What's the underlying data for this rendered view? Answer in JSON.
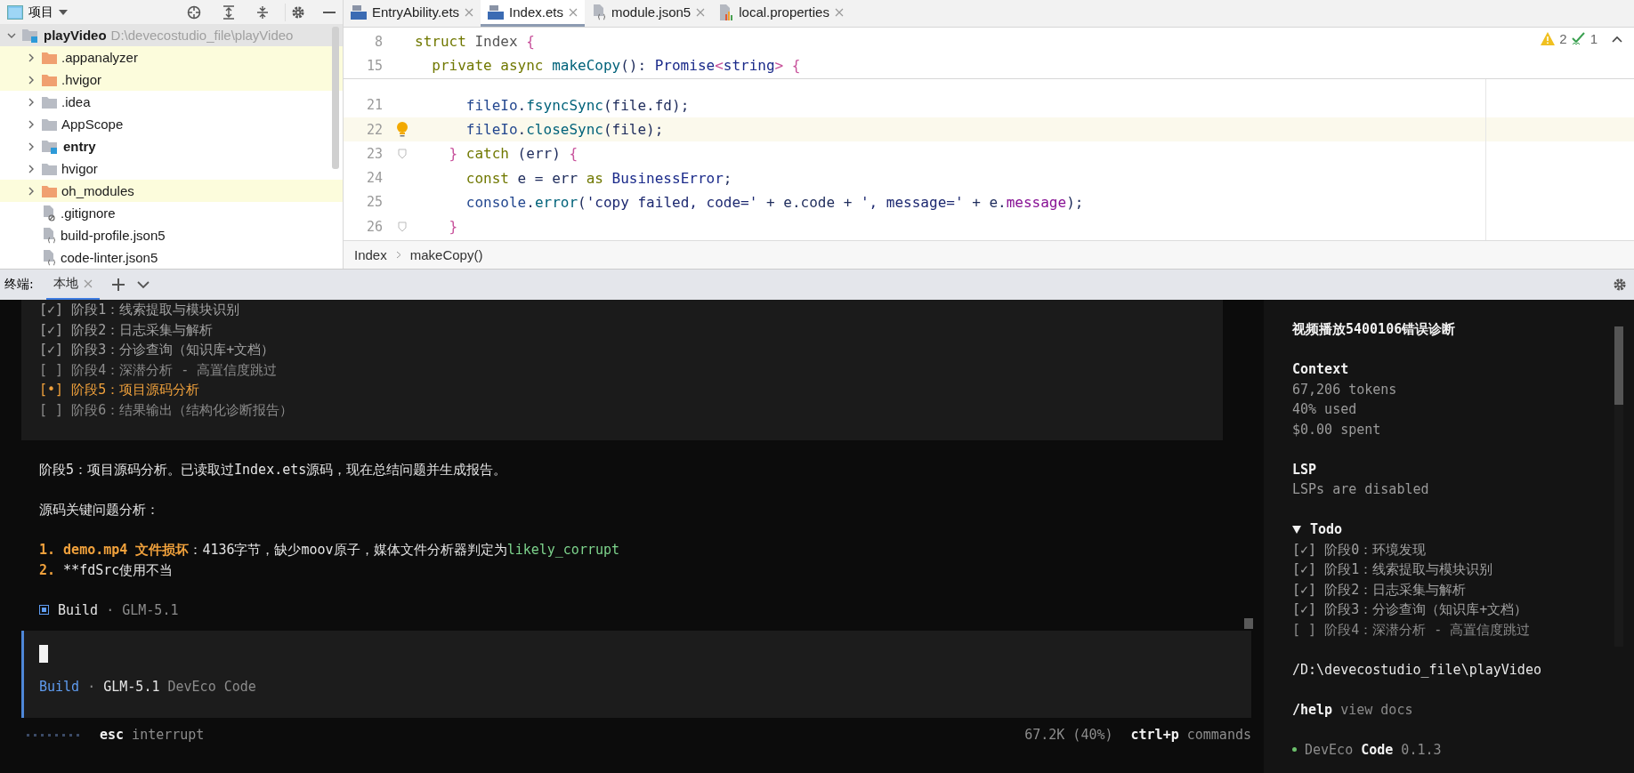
{
  "project_panel": {
    "title": "项目",
    "tree": [
      {
        "name": "playVideo",
        "path": "D:\\devecostudio_file\\playVideo",
        "kind": "project",
        "expanded": true,
        "selected": true,
        "ignored": false,
        "children": [
          {
            "name": ".appanalyzer",
            "kind": "folder",
            "expanded": false,
            "selected": false,
            "ignored": true
          },
          {
            "name": ".hvigor",
            "kind": "folder",
            "expanded": false,
            "selected": false,
            "ignored": true
          },
          {
            "name": ".idea",
            "kind": "folder",
            "expanded": false,
            "selected": false,
            "ignored": false
          },
          {
            "name": "AppScope",
            "kind": "folder",
            "expanded": false,
            "selected": false,
            "ignored": false
          },
          {
            "name": "entry",
            "kind": "module",
            "expanded": false,
            "selected": false,
            "ignored": false
          },
          {
            "name": "hvigor",
            "kind": "folder",
            "expanded": false,
            "selected": false,
            "ignored": false
          },
          {
            "name": "oh_modules",
            "kind": "folder",
            "expanded": false,
            "selected": false,
            "ignored": true
          },
          {
            "name": ".gitignore",
            "kind": "ignorefile",
            "selected": false,
            "ignored": false
          },
          {
            "name": "build-profile.json5",
            "kind": "jsonfile",
            "selected": false,
            "ignored": false
          },
          {
            "name": "code-linter.json5",
            "kind": "jsonfile",
            "selected": false,
            "ignored": false
          }
        ]
      }
    ]
  },
  "editor": {
    "tabs": [
      {
        "label": "EntryAbility.ets",
        "kind": "ets",
        "selected": false
      },
      {
        "label": "Index.ets",
        "kind": "ets",
        "selected": true
      },
      {
        "label": "module.json5",
        "kind": "json",
        "selected": false
      },
      {
        "label": "local.properties",
        "kind": "properties",
        "selected": false
      }
    ],
    "inspections": {
      "warnings": "2",
      "weak_warnings": "1"
    },
    "sticky_lines": [
      {
        "number": "8",
        "tokens": [
          {
            "kind": "kw",
            "text": "struct"
          },
          {
            "kind": "id",
            "text": " Index "
          },
          {
            "kind": "br",
            "text": "{"
          }
        ]
      },
      {
        "number": "15",
        "tokens": [
          {
            "kind": "kw",
            "text": "  private async "
          },
          {
            "kind": "fn",
            "text": "makeCopy"
          },
          {
            "kind": "pl",
            "text": "(): "
          },
          {
            "kind": "ty",
            "text": "Promise"
          },
          {
            "kind": "br",
            "text": "<"
          },
          {
            "kind": "ty",
            "text": "string"
          },
          {
            "kind": "br",
            "text": ">"
          },
          {
            "kind": "br",
            "text": " {"
          }
        ]
      }
    ],
    "lines": [
      {
        "number": "21",
        "current": false,
        "fold": false,
        "tokens": [
          {
            "kind": "ob",
            "text": "      fileIo"
          },
          {
            "kind": "pl",
            "text": "."
          },
          {
            "kind": "fn",
            "text": "fsyncSync"
          },
          {
            "kind": "pl",
            "text": "(file.fd);"
          }
        ]
      },
      {
        "number": "22",
        "current": true,
        "fold": false,
        "tokens": [
          {
            "kind": "ob",
            "text": "      fileIo"
          },
          {
            "kind": "pl",
            "text": "."
          },
          {
            "kind": "fn",
            "text": "closeSync"
          },
          {
            "kind": "pl",
            "text": "(file);"
          }
        ]
      },
      {
        "number": "23",
        "current": false,
        "fold": true,
        "tokens": [
          {
            "kind": "br",
            "text": "    }"
          },
          {
            "kind": "kw",
            "text": " catch "
          },
          {
            "kind": "pl",
            "text": "(err) "
          },
          {
            "kind": "br",
            "text": "{"
          }
        ]
      },
      {
        "number": "24",
        "current": false,
        "fold": false,
        "tokens": [
          {
            "kind": "kw",
            "text": "      const"
          },
          {
            "kind": "pl",
            "text": " e = err "
          },
          {
            "kind": "kw",
            "text": "as"
          },
          {
            "kind": "ty",
            "text": " BusinessError"
          },
          {
            "kind": "pl",
            "text": ";"
          }
        ]
      },
      {
        "number": "25",
        "current": false,
        "fold": false,
        "tokens": [
          {
            "kind": "ob",
            "text": "      console"
          },
          {
            "kind": "pl",
            "text": "."
          },
          {
            "kind": "fn",
            "text": "error"
          },
          {
            "kind": "pl",
            "text": "("
          },
          {
            "kind": "st",
            "text": "'copy failed, code='"
          },
          {
            "kind": "pl",
            "text": " + e.code + "
          },
          {
            "kind": "st",
            "text": "', message='"
          },
          {
            "kind": "pl",
            "text": " + e."
          },
          {
            "kind": "pr",
            "text": "message"
          },
          {
            "kind": "pl",
            "text": ");"
          }
        ]
      },
      {
        "number": "26",
        "current": false,
        "fold": true,
        "tokens": [
          {
            "kind": "br",
            "text": "    }"
          }
        ]
      }
    ],
    "breadcrumb": [
      "Index",
      "makeCopy()"
    ]
  },
  "terminal": {
    "label": "终端:",
    "tabs": [
      {
        "label": "本地",
        "selected": true
      }
    ],
    "todo_box": [
      {
        "mark": "[✓]",
        "text": "阶段1：线索提取与模块识别",
        "kind": "done"
      },
      {
        "mark": "[✓]",
        "text": "阶段2：日志采集与解析",
        "kind": "done"
      },
      {
        "mark": "[✓]",
        "text": "阶段3：分诊查询（知识库+文档）",
        "kind": "done"
      },
      {
        "mark": "[ ]",
        "text": "阶段4：深潜分析 - 高置信度跳过",
        "kind": "pending"
      },
      {
        "mark": "[•]",
        "text": "阶段5：项目源码分析",
        "kind": "active"
      },
      {
        "mark": "[ ]",
        "text": "阶段6：结果输出（结构化诊断报告）",
        "kind": "pending"
      }
    ],
    "messages": [
      [
        {
          "text": "阶段5：项目源码分析。已读取过Index.ets源码，现在总结问题并生成报告。",
          "kind": "normal"
        }
      ],
      [
        {
          "text": "源码关键问题分析：",
          "kind": "normal"
        }
      ],
      [
        {
          "text": "1. demo.mp4 文件损坏",
          "kind": "accent"
        },
        {
          "text": "：4136字节，缺少moov原子，媒体文件分析器判定为",
          "kind": "normal"
        },
        {
          "text": "likely_corrupt",
          "kind": "green"
        }
      ],
      [
        {
          "text": "2. ",
          "kind": "accent"
        },
        {
          "text": "**fdSrc使用不当",
          "kind": "normal"
        }
      ]
    ],
    "build_line": [
      {
        "text": "Build",
        "kind": "normal"
      },
      {
        "text": " · GLM-5.1",
        "kind": "dim"
      }
    ],
    "prompt_meta": [
      {
        "text": "Build",
        "kind": "blue"
      },
      {
        "text": " · ",
        "kind": "dim"
      },
      {
        "text": "GLM-5.1",
        "kind": "normal"
      },
      {
        "text": " DevEco Code",
        "kind": "dim"
      }
    ],
    "status_left": [
      {
        "text": "esc",
        "kind": "strong"
      },
      {
        "text": " interrupt",
        "kind": "dim"
      }
    ],
    "status_usage": "67.2K (40%)",
    "status_right": [
      {
        "text": "ctrl+p",
        "kind": "strong"
      },
      {
        "text": " commands",
        "kind": "dim"
      }
    ]
  },
  "sidebar": {
    "title": "视频播放5400106错误诊断",
    "context": {
      "heading": "Context",
      "lines": [
        "67,206 tokens",
        "40% used",
        "$0.00 spent"
      ]
    },
    "lsp": {
      "heading": "LSP",
      "lines": [
        "LSPs are disabled"
      ]
    },
    "todo": {
      "heading": "Todo",
      "expanded": true,
      "items": [
        {
          "mark": "[✓]",
          "text": "阶段0：环境发现",
          "kind": "done"
        },
        {
          "mark": "[✓]",
          "text": "阶段1：线索提取与模块识别",
          "kind": "done"
        },
        {
          "mark": "[✓]",
          "text": "阶段2：日志采集与解析",
          "kind": "done"
        },
        {
          "mark": "[✓]",
          "text": "阶段3：分诊查询（知识库+文档）",
          "kind": "done"
        },
        {
          "mark": "[ ]",
          "text": "阶段4：深潜分析 - 高置信度跳过",
          "kind": "pending"
        }
      ]
    },
    "path": "/D:\\devecostudio_file\\playVideo",
    "help": [
      {
        "text": "/help",
        "kind": "strong"
      },
      {
        "text": " view docs",
        "kind": "dim"
      }
    ],
    "version": [
      {
        "text": "DevEco",
        "kind": "dim"
      },
      {
        "text": " Code",
        "kind": "strong"
      },
      {
        "text": " 0.1.3",
        "kind": "dim"
      }
    ]
  }
}
